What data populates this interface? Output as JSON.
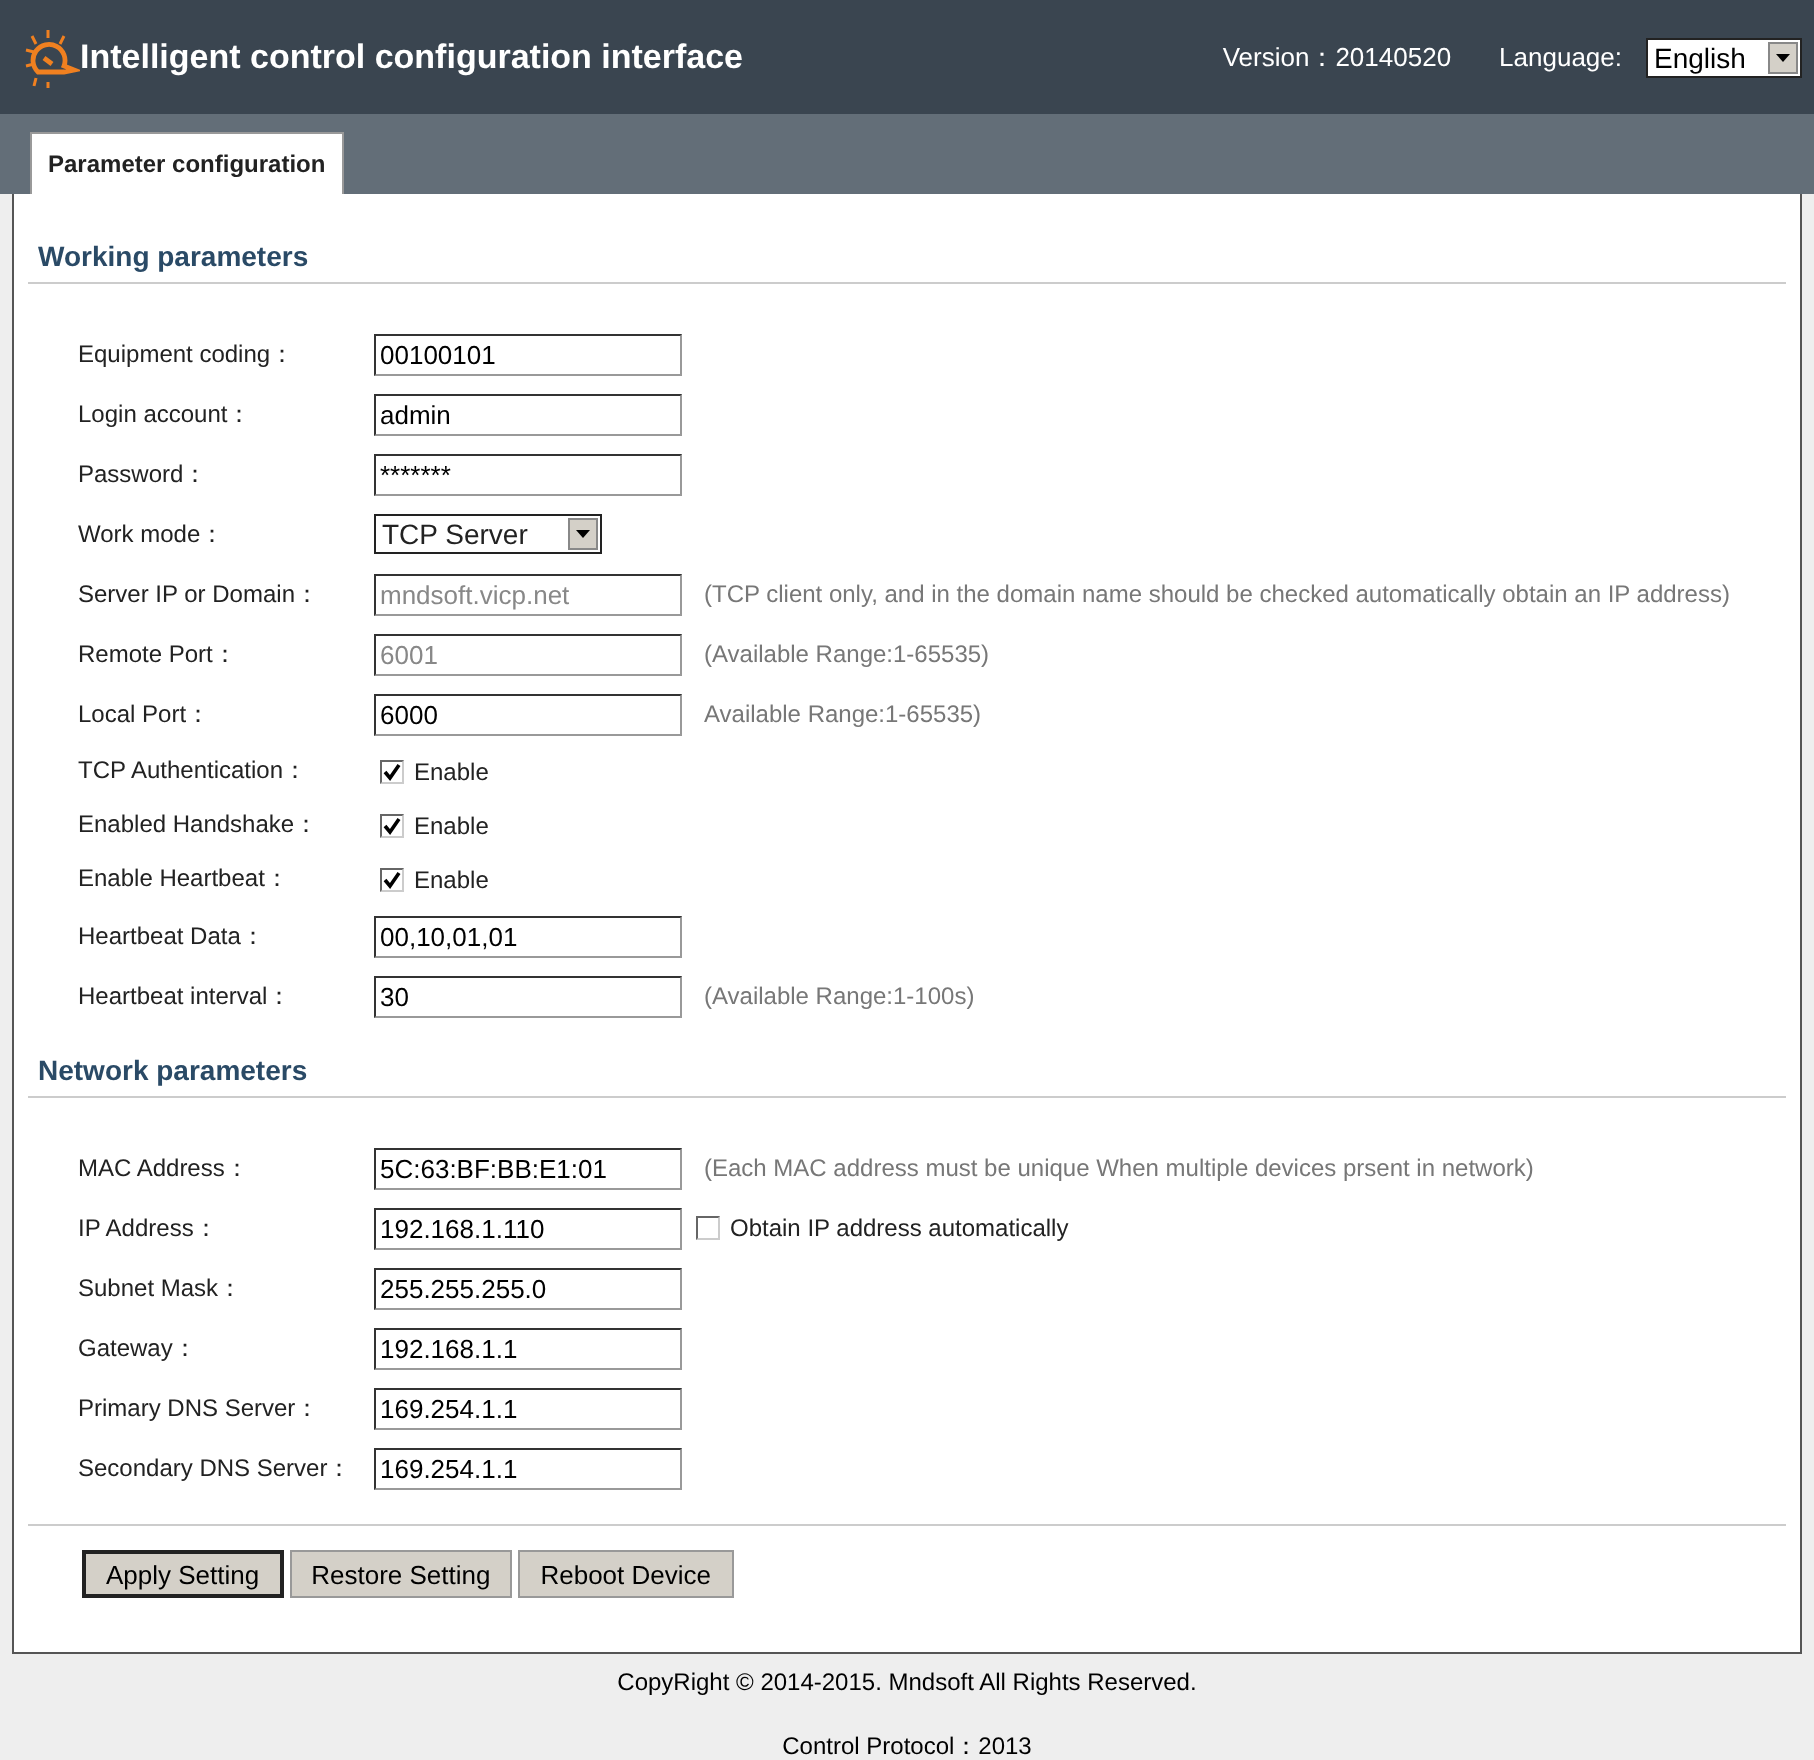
{
  "header": {
    "title": "Intelligent control configuration interface",
    "version": "Version：20140520",
    "language_label": "Language:",
    "language": "English"
  },
  "tabs": [
    {
      "label": "Parameter configuration",
      "selected": true
    }
  ],
  "sections": [
    {
      "title": "Working parameters",
      "fields": [
        {
          "kind": "text",
          "label": "Equipment coding：",
          "value": "00100101",
          "disabled": false
        },
        {
          "kind": "text",
          "label": "Login account：",
          "value": "admin",
          "disabled": false
        },
        {
          "kind": "text",
          "label": "Password：",
          "value": "*******",
          "disabled": false
        },
        {
          "kind": "select",
          "label": "Work mode：",
          "value": "TCP Server"
        },
        {
          "kind": "text",
          "label": "Server IP or Domain：",
          "value": "mndsoft.vicp.net",
          "disabled": true,
          "hint": "(TCP client only, and in the domain name should be checked automatically obtain an IP address)"
        },
        {
          "kind": "text",
          "label": "Remote Port：",
          "value": "6001",
          "disabled": true,
          "hint": "(Available Range:1-65535)"
        },
        {
          "kind": "text",
          "label": "Local Port：",
          "value": "6000",
          "disabled": false,
          "hint": "Available Range:1-65535)"
        },
        {
          "kind": "checkbox",
          "label": "TCP Authentication：",
          "option": "Enable",
          "checked": true
        },
        {
          "kind": "checkbox",
          "label": "Enabled Handshake：",
          "option": "Enable",
          "checked": true
        },
        {
          "kind": "checkbox",
          "label": "Enable Heartbeat：",
          "option": "Enable",
          "checked": true
        },
        {
          "kind": "text",
          "label": "Heartbeat Data：",
          "value": "00,10,01,01",
          "disabled": false
        },
        {
          "kind": "text",
          "label": "Heartbeat interval：",
          "value": "30",
          "disabled": false,
          "hint": "(Available Range:1-100s)"
        }
      ]
    },
    {
      "title": "Network parameters",
      "fields": [
        {
          "kind": "text",
          "label": "MAC Address：",
          "value": "5C:63:BF:BB:E1:01",
          "disabled": false,
          "hint": "(Each MAC address must be unique When multiple devices prsent in network)"
        },
        {
          "kind": "text",
          "label": "IP Address：",
          "value": "192.168.1.110",
          "disabled": false,
          "option": {
            "label": "Obtain IP address automatically",
            "checked": false
          }
        },
        {
          "kind": "text",
          "label": "Subnet Mask：",
          "value": "255.255.255.0",
          "disabled": false
        },
        {
          "kind": "text",
          "label": "Gateway：",
          "value": "192.168.1.1",
          "disabled": false
        },
        {
          "kind": "text",
          "label": "Primary DNS Server：",
          "value": "169.254.1.1",
          "disabled": false
        },
        {
          "kind": "text",
          "label": "Secondary DNS Server：",
          "value": "169.254.1.1",
          "disabled": false
        }
      ]
    }
  ],
  "buttons": [
    {
      "label": "Apply Setting",
      "focused": true
    },
    {
      "label": "Restore Setting",
      "focused": false
    },
    {
      "label": "Reboot Device",
      "focused": false
    }
  ],
  "footer": {
    "copyright": "CopyRight © 2014-2015. Mndsoft All Rights Reserved.",
    "protocol": "Control Protocol：2013"
  }
}
